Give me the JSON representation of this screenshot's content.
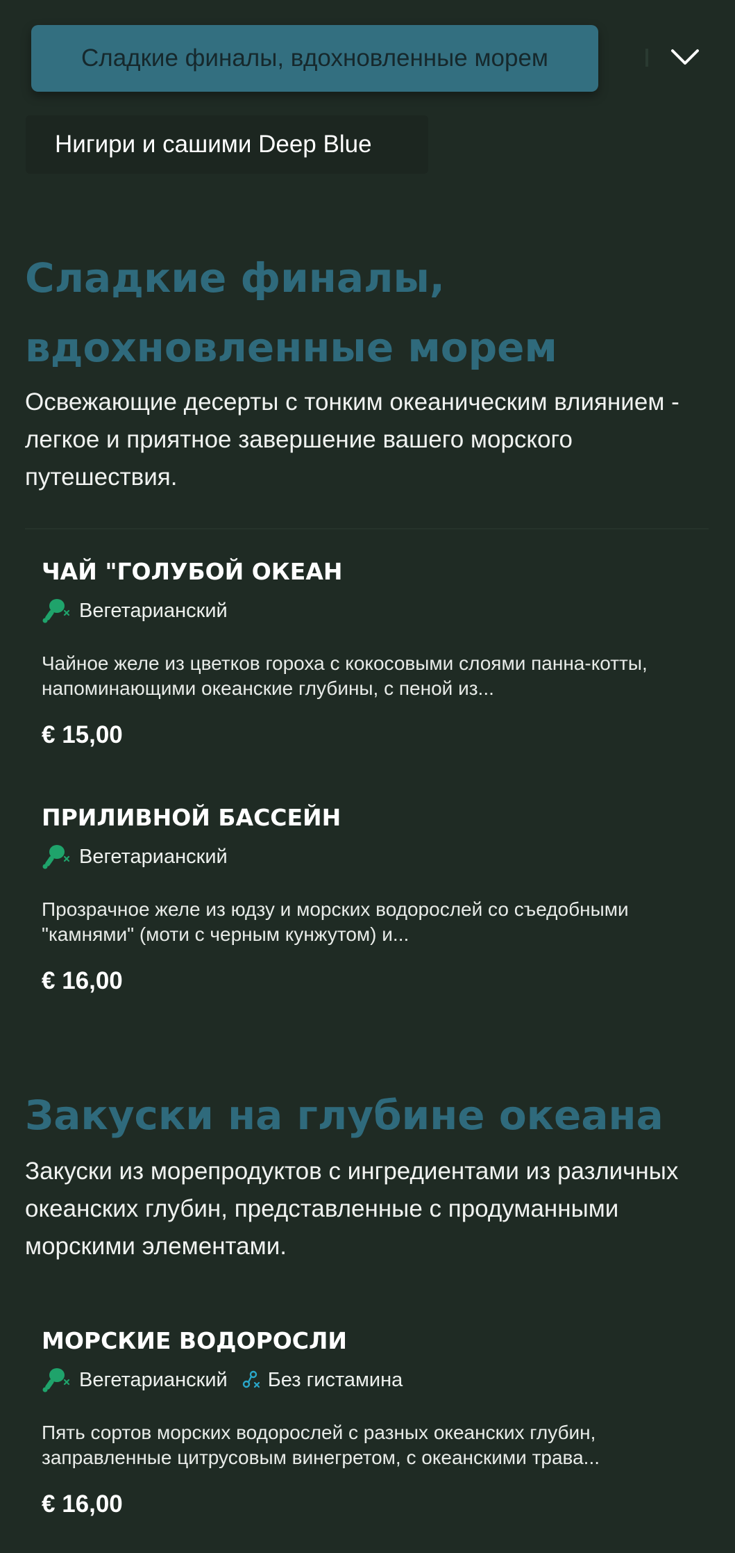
{
  "nav": {
    "active_tab": "Сладкие финалы, вдохновленные морем",
    "second_tab": "Нигири и сашими Deep Blue"
  },
  "sections": [
    {
      "title": "Сладкие финалы, вдохновленные морем",
      "description": "Освежающие десерты с тонким океаническим влиянием - легкое и приятное завершение вашего морского путешествия.",
      "items": [
        {
          "name": "ЧАЙ \"ГОЛУБОЙ ОКЕАН",
          "tags": [
            "Вегетарианский"
          ],
          "description": "Чайное желе из цветков гороха с кокосовыми слоями панна-котты, напоминающими океанские глубины, с пеной из...",
          "price": "€ 15,00"
        },
        {
          "name": "ПРИЛИВНОЙ БАССЕЙН",
          "tags": [
            "Вегетарианский"
          ],
          "description": "Прозрачное желе из юдзу и морских водорослей со съедобными \"камнями\" (моти с черным кунжутом) и...",
          "price": "€ 16,00"
        }
      ]
    },
    {
      "title": "Закуски на глубине океана",
      "description": "Закуски из морепродуктов с ингредиентами из различных океанских глубин, представленные с продуманными морскими элементами.",
      "items": [
        {
          "name": "МОРСКИЕ ВОДОРОСЛИ",
          "tags": [
            "Вегетарианский",
            "Без гистамина"
          ],
          "description": "Пять сортов морских водорослей с разных океанских глубин, заправленные цитрусовым винегретом, с океанскими трава...",
          "price": "€ 16,00"
        }
      ]
    }
  ],
  "icons": {
    "dropdown": "chevron-down-icon",
    "vegetarian": "vegetarian-drumstick-icon",
    "histamine_free": "histamine-free-icon"
  },
  "colors": {
    "background": "#1f2b24",
    "accent": "#336f80",
    "section_title": "#2f6a7c",
    "vegetarian_icon": "#1fa36b",
    "histamine_icon": "#2aa7c9"
  }
}
